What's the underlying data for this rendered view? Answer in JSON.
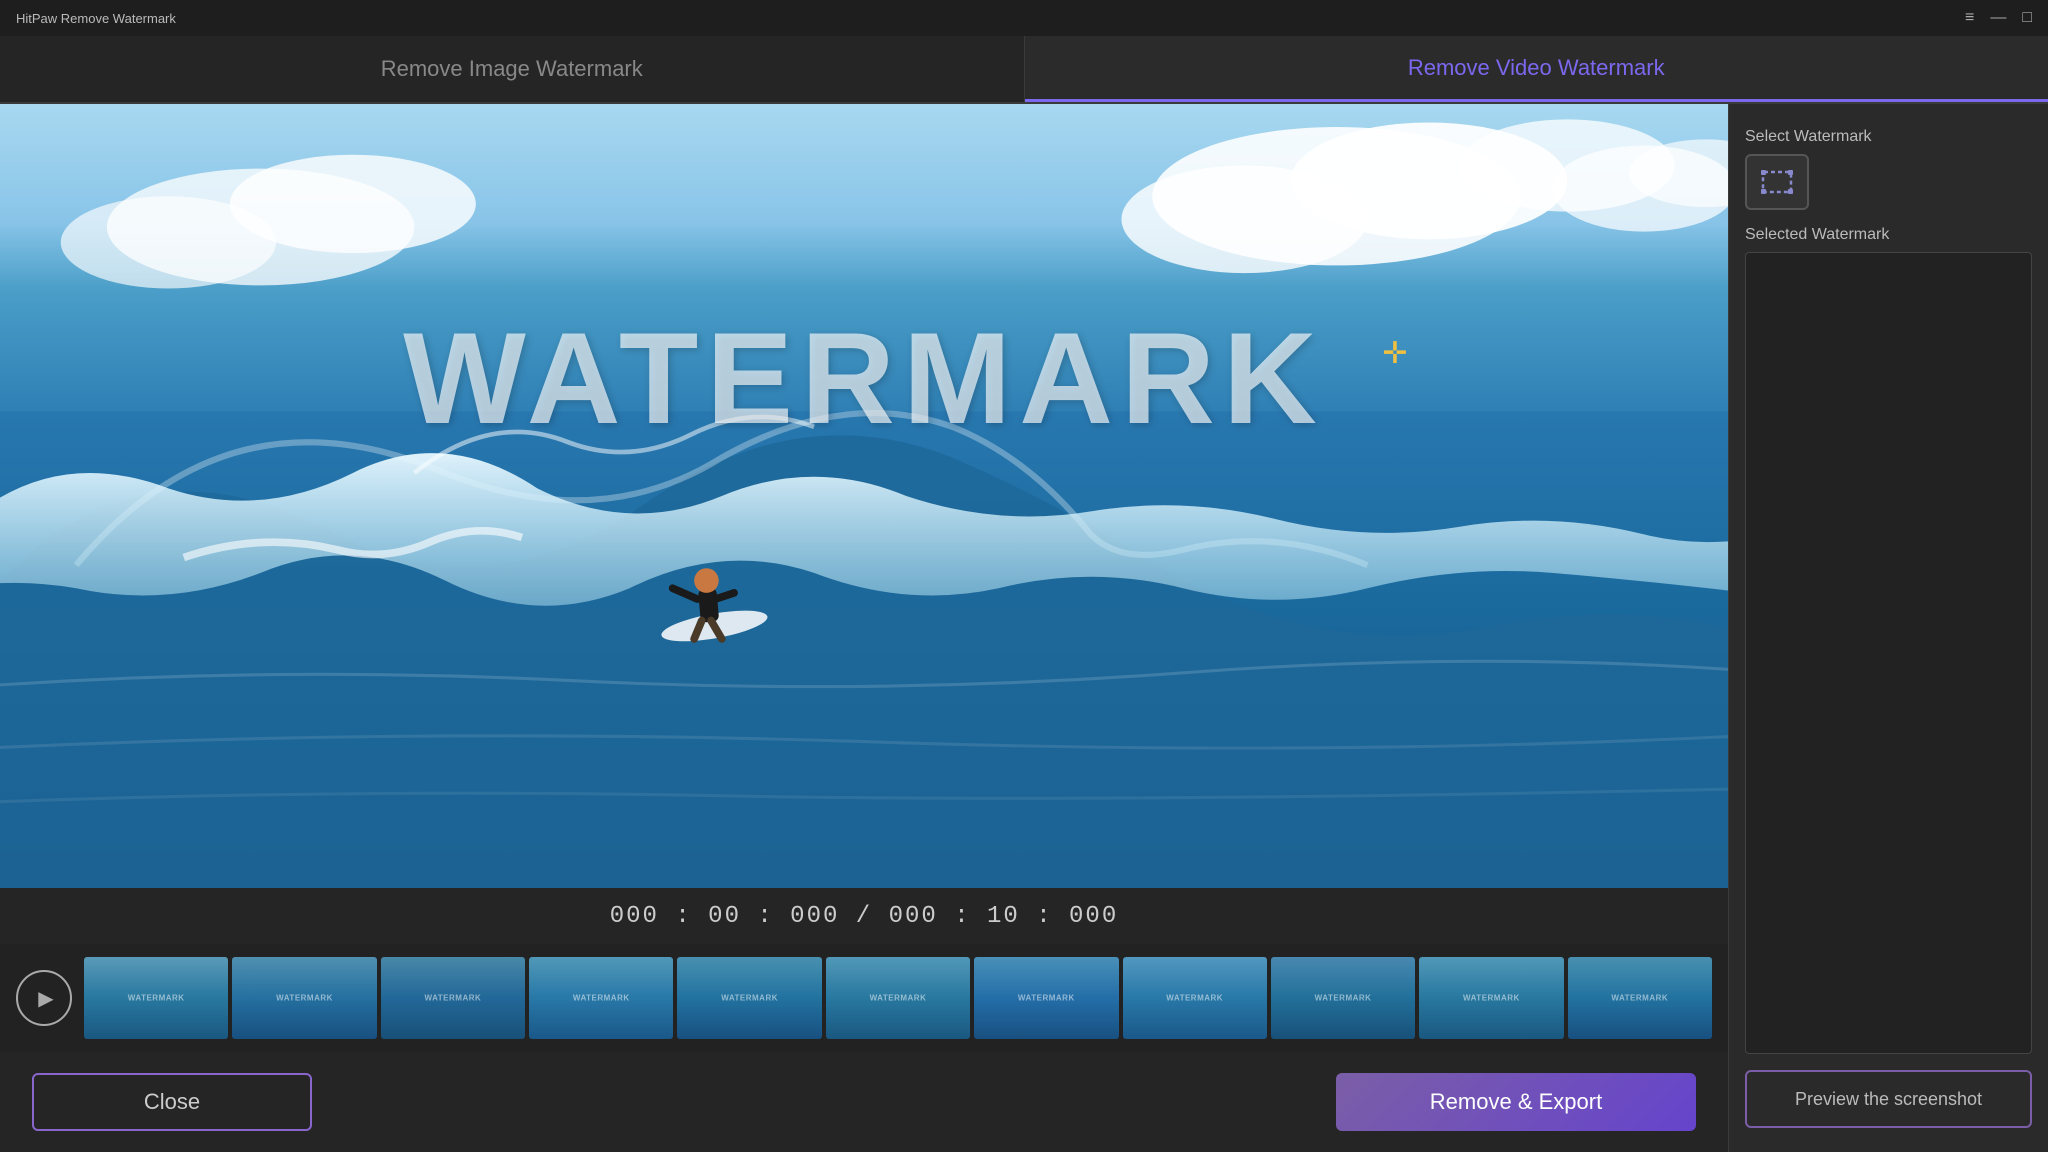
{
  "app": {
    "title": "HitPaw Remove Watermark"
  },
  "titlebar": {
    "title": "HitPaw Remove Watermark",
    "controls": [
      "menu-icon",
      "minimize-icon",
      "maximize-icon"
    ]
  },
  "tabs": [
    {
      "id": "image",
      "label": "Remove Image Watermark",
      "active": false
    },
    {
      "id": "video",
      "label": "Remove Video Watermark",
      "active": true
    }
  ],
  "video": {
    "watermark_text": "WATERMARK",
    "time_display": "000 : 00 : 000 / 000 : 10 : 000"
  },
  "filmstrip": {
    "frame_label": "WATERMARK",
    "frame_count": 11
  },
  "right_panel": {
    "select_watermark_label": "Select Watermark",
    "selected_watermark_label": "Selected Watermark",
    "preview_btn_label": "Preview the screenshot"
  },
  "bottom": {
    "close_label": "Close",
    "export_label": "Remove & Export"
  }
}
